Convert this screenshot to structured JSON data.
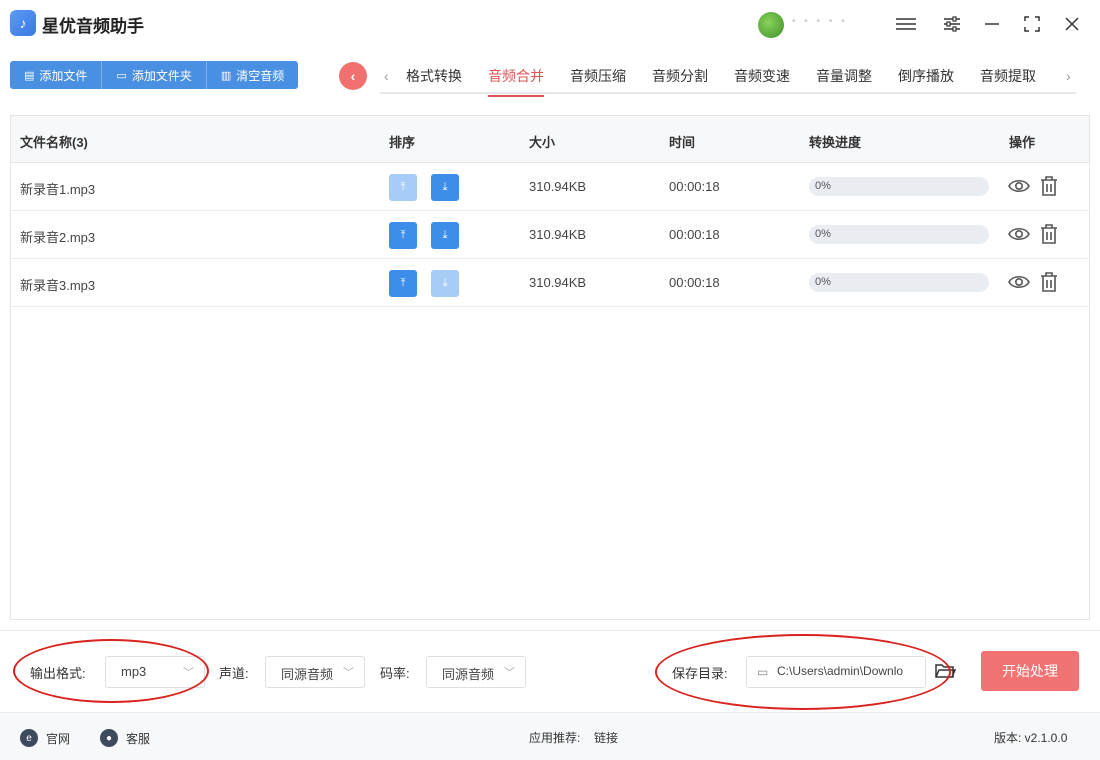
{
  "app": {
    "title": "星优音频助手",
    "username": "• • • • •"
  },
  "toolbar": {
    "add_file": "添加文件",
    "add_folder": "添加文件夹",
    "clear_audio": "清空音频"
  },
  "tabs": [
    "格式转换",
    "音频合并",
    "音频压缩",
    "音频分割",
    "音频变速",
    "音量调整",
    "倒序播放",
    "音频提取"
  ],
  "active_tab": "音频合并",
  "table": {
    "headers": {
      "name": "文件名称(3)",
      "sort": "排序",
      "size": "大小",
      "time": "时间",
      "progress": "转换进度",
      "ops": "操作"
    },
    "rows": [
      {
        "name": "新录音1.mp3",
        "size": "310.94KB",
        "time": "00:00:18",
        "progress_label": "0%",
        "progress": 0,
        "up_enabled": false,
        "down_enabled": true
      },
      {
        "name": "新录音2.mp3",
        "size": "310.94KB",
        "time": "00:00:18",
        "progress_label": "0%",
        "progress": 0,
        "up_enabled": true,
        "down_enabled": true
      },
      {
        "name": "新录音3.mp3",
        "size": "310.94KB",
        "time": "00:00:18",
        "progress_label": "0%",
        "progress": 0,
        "up_enabled": true,
        "down_enabled": false
      }
    ]
  },
  "settings": {
    "format_label": "输出格式:",
    "format_value": "mp3",
    "channel_label": "声道:",
    "channel_value": "同源音频",
    "bitrate_label": "码率:",
    "bitrate_value": "同源音频",
    "save_label": "保存目录:",
    "save_path": "C:\\Users\\admin\\Downlo",
    "start_button": "开始处理"
  },
  "footer": {
    "website": "官网",
    "service": "客服",
    "recommend": "应用推荐:",
    "link": "链接",
    "version": "版本: v2.1.0.0"
  },
  "colors": {
    "primary": "#4a90e2",
    "accent": "#e35454",
    "start": "#f07272",
    "annotation": "#d9231d"
  }
}
